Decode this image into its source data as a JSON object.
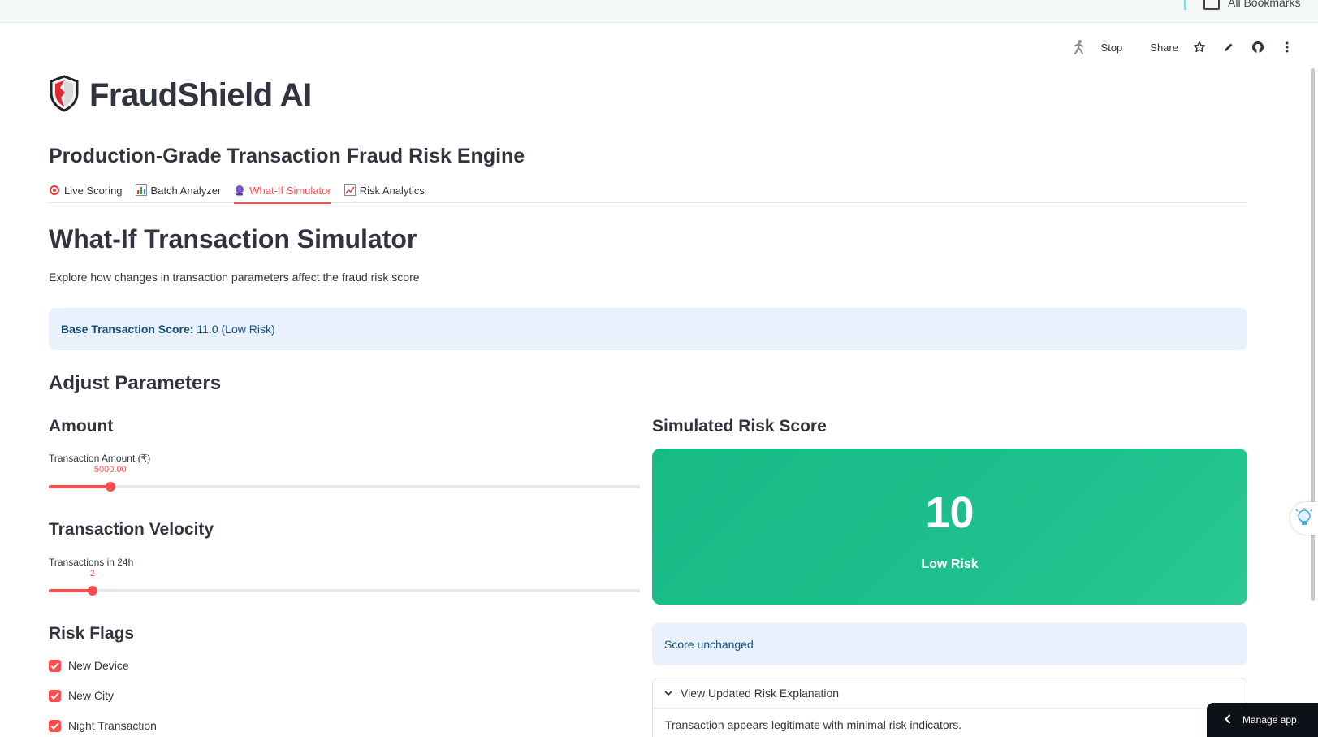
{
  "browser": {
    "bookmarks_label": "All Bookmarks"
  },
  "toolbar": {
    "stop_label": "Stop",
    "share_label": "Share"
  },
  "app": {
    "title": "FraudShield AI",
    "subtitle": "Production-Grade Transaction Fraud Risk Engine"
  },
  "tabs": [
    {
      "label": "Live Scoring",
      "icon": "target-icon"
    },
    {
      "label": "Batch Analyzer",
      "icon": "bar-chart-icon"
    },
    {
      "label": "What-If Simulator",
      "icon": "crystal-ball-icon",
      "active": true
    },
    {
      "label": "Risk Analytics",
      "icon": "trend-chart-icon"
    }
  ],
  "simulator": {
    "title": "What-If Transaction Simulator",
    "description": "Explore how changes in transaction parameters affect the fraud risk score",
    "base_score_label": "Base Transaction Score:",
    "base_score_value": "11.0 (Low Risk)"
  },
  "parameters": {
    "heading": "Adjust Parameters",
    "amount": {
      "heading": "Amount",
      "label": "Transaction Amount (₹)",
      "value": "5000.00",
      "fraction": 0.104
    },
    "velocity": {
      "heading": "Transaction Velocity",
      "label": "Transactions in 24h",
      "value": "2",
      "fraction": 0.074
    },
    "flags": {
      "heading": "Risk Flags",
      "items": [
        {
          "label": "New Device",
          "checked": true
        },
        {
          "label": "New City",
          "checked": true
        },
        {
          "label": "Night Transaction",
          "checked": true
        }
      ]
    }
  },
  "result": {
    "heading": "Simulated Risk Score",
    "score": "10",
    "level": "Low Risk",
    "change_text": "Score unchanged",
    "expander_label": "View Updated Risk Explanation",
    "explanation": "Transaction appears legitimate with minimal risk indicators."
  },
  "manage_app_label": "Manage app",
  "colors": {
    "accent": "#ff4b4b",
    "low_risk": "#1ec08d",
    "info_bg": "#e8f1fc",
    "info_text": "#1a4f7a"
  }
}
